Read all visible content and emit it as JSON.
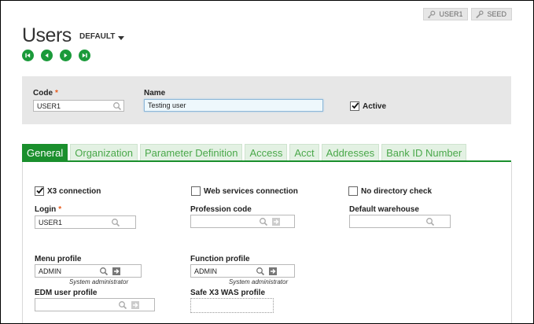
{
  "topbar": {
    "user_label": "USER1",
    "folder_label": "SEED"
  },
  "page": {
    "title": "Users",
    "variant": "DEFAULT"
  },
  "header": {
    "code_label": "Code",
    "code_value": "USER1",
    "name_label": "Name",
    "name_value": "Testing user",
    "active_label": "Active",
    "active_checked": true
  },
  "tabs": [
    {
      "label": "General",
      "active": true
    },
    {
      "label": "Organization"
    },
    {
      "label": "Parameter Definition"
    },
    {
      "label": "Access"
    },
    {
      "label": "Acct"
    },
    {
      "label": "Addresses"
    },
    {
      "label": "Bank ID Number"
    }
  ],
  "general": {
    "x3_connection": {
      "label": "X3 connection",
      "checked": true
    },
    "web_services": {
      "label": "Web services connection",
      "checked": false
    },
    "no_directory": {
      "label": "No directory check",
      "checked": false
    },
    "login_label": "Login",
    "login_value": "USER1",
    "profession_label": "Profession code",
    "profession_value": "",
    "warehouse_label": "Default warehouse",
    "warehouse_value": "",
    "menu_label": "Menu profile",
    "menu_value": "ADMIN",
    "menu_desc": "System administrator",
    "function_label": "Function profile",
    "function_value": "ADMIN",
    "function_desc": "System administrator",
    "edm_label": "EDM user profile",
    "edm_value": "",
    "safe_label": "Safe X3 WAS profile",
    "safe_value": ""
  },
  "colors": {
    "accent": "#1a8f2d",
    "required": "#e85a1a"
  }
}
